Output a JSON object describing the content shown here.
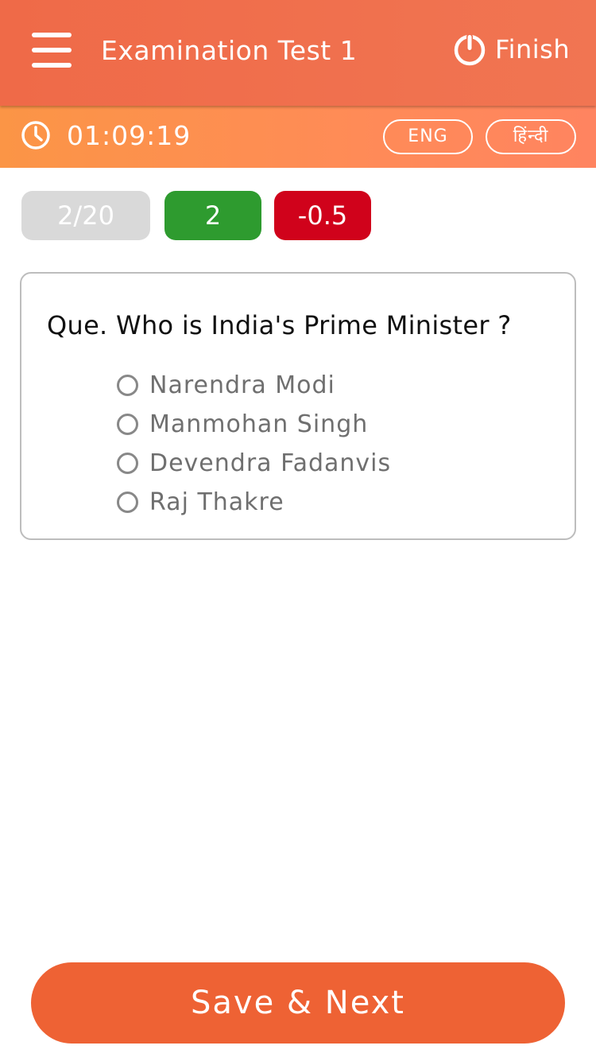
{
  "header": {
    "title": "Examination Test 1",
    "finish_label": "Finish",
    "menu_icon": "hamburger-menu-icon",
    "finish_icon": "power-icon"
  },
  "timer_bar": {
    "clock_icon": "clock-icon",
    "time_remaining": "01:09:19",
    "languages": [
      "ENG",
      "हिंन्दी"
    ]
  },
  "badges": {
    "progress": "2/20",
    "marks_correct": "2",
    "marks_negative": "-0.5"
  },
  "question": {
    "text": "Que. Who is India's Prime Minister ?",
    "options": [
      {
        "label": "Narendra Modi",
        "selected": false
      },
      {
        "label": "Manmohan Singh",
        "selected": false
      },
      {
        "label": "Devendra Fadanvis",
        "selected": false
      },
      {
        "label": "Raj Thakre",
        "selected": false
      }
    ]
  },
  "footer": {
    "save_next_label": "Save & Next"
  },
  "colors": {
    "header": "#ef6a48",
    "timer_bar": "#ff8b57",
    "correct": "#2e9b2f",
    "negative": "#d0021b",
    "progress": "#d9d9d9",
    "primary_button": "#ee6234"
  }
}
